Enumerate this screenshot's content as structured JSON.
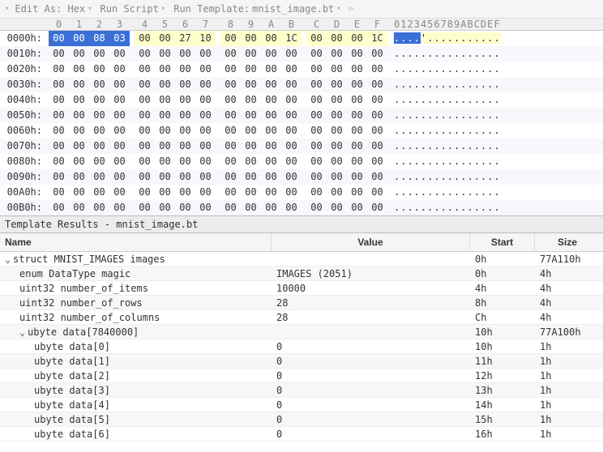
{
  "toolbar": {
    "edit_as": "Edit As: Hex",
    "run_script": "Run Script",
    "run_template_label": "Run Template:",
    "run_template_value": "mnist_image.bt"
  },
  "hex_header": [
    "0",
    "1",
    "2",
    "3",
    "4",
    "5",
    "6",
    "7",
    "8",
    "9",
    "A",
    "B",
    "C",
    "D",
    "E",
    "F"
  ],
  "ascii_header": "0123456789ABCDEF",
  "hex_rows": [
    {
      "addr": "0000h:",
      "bytes": [
        "00",
        "00",
        "08",
        "03",
        "00",
        "00",
        "27",
        "10",
        "00",
        "00",
        "00",
        "1C",
        "00",
        "00",
        "00",
        "1C"
      ],
      "ascii": "....'..........."
    },
    {
      "addr": "0010h:",
      "bytes": [
        "00",
        "00",
        "00",
        "00",
        "00",
        "00",
        "00",
        "00",
        "00",
        "00",
        "00",
        "00",
        "00",
        "00",
        "00",
        "00"
      ],
      "ascii": "................"
    },
    {
      "addr": "0020h:",
      "bytes": [
        "00",
        "00",
        "00",
        "00",
        "00",
        "00",
        "00",
        "00",
        "00",
        "00",
        "00",
        "00",
        "00",
        "00",
        "00",
        "00"
      ],
      "ascii": "................"
    },
    {
      "addr": "0030h:",
      "bytes": [
        "00",
        "00",
        "00",
        "00",
        "00",
        "00",
        "00",
        "00",
        "00",
        "00",
        "00",
        "00",
        "00",
        "00",
        "00",
        "00"
      ],
      "ascii": "................"
    },
    {
      "addr": "0040h:",
      "bytes": [
        "00",
        "00",
        "00",
        "00",
        "00",
        "00",
        "00",
        "00",
        "00",
        "00",
        "00",
        "00",
        "00",
        "00",
        "00",
        "00"
      ],
      "ascii": "................"
    },
    {
      "addr": "0050h:",
      "bytes": [
        "00",
        "00",
        "00",
        "00",
        "00",
        "00",
        "00",
        "00",
        "00",
        "00",
        "00",
        "00",
        "00",
        "00",
        "00",
        "00"
      ],
      "ascii": "................"
    },
    {
      "addr": "0060h:",
      "bytes": [
        "00",
        "00",
        "00",
        "00",
        "00",
        "00",
        "00",
        "00",
        "00",
        "00",
        "00",
        "00",
        "00",
        "00",
        "00",
        "00"
      ],
      "ascii": "................"
    },
    {
      "addr": "0070h:",
      "bytes": [
        "00",
        "00",
        "00",
        "00",
        "00",
        "00",
        "00",
        "00",
        "00",
        "00",
        "00",
        "00",
        "00",
        "00",
        "00",
        "00"
      ],
      "ascii": "................"
    },
    {
      "addr": "0080h:",
      "bytes": [
        "00",
        "00",
        "00",
        "00",
        "00",
        "00",
        "00",
        "00",
        "00",
        "00",
        "00",
        "00",
        "00",
        "00",
        "00",
        "00"
      ],
      "ascii": "................"
    },
    {
      "addr": "0090h:",
      "bytes": [
        "00",
        "00",
        "00",
        "00",
        "00",
        "00",
        "00",
        "00",
        "00",
        "00",
        "00",
        "00",
        "00",
        "00",
        "00",
        "00"
      ],
      "ascii": "................"
    },
    {
      "addr": "00A0h:",
      "bytes": [
        "00",
        "00",
        "00",
        "00",
        "00",
        "00",
        "00",
        "00",
        "00",
        "00",
        "00",
        "00",
        "00",
        "00",
        "00",
        "00"
      ],
      "ascii": "................"
    },
    {
      "addr": "00B0h:",
      "bytes": [
        "00",
        "00",
        "00",
        "00",
        "00",
        "00",
        "00",
        "00",
        "00",
        "00",
        "00",
        "00",
        "00",
        "00",
        "00",
        "00"
      ],
      "ascii": "................"
    }
  ],
  "results_title": "Template Results - mnist_image.bt",
  "results_header": {
    "name": "Name",
    "value": "Value",
    "start": "Start",
    "size": "Size"
  },
  "results_rows": [
    {
      "indent": 0,
      "exp": "v",
      "name": "struct MNIST_IMAGES images",
      "value": "",
      "start": "0h",
      "size": "77A110h"
    },
    {
      "indent": 1,
      "exp": "",
      "name": "enum DataType magic",
      "value": "IMAGES (2051)",
      "start": "0h",
      "size": "4h"
    },
    {
      "indent": 1,
      "exp": "",
      "name": "uint32 number_of_items",
      "value": "10000",
      "start": "4h",
      "size": "4h"
    },
    {
      "indent": 1,
      "exp": "",
      "name": "uint32 number_of_rows",
      "value": "28",
      "start": "8h",
      "size": "4h"
    },
    {
      "indent": 1,
      "exp": "",
      "name": "uint32 number_of_columns",
      "value": "28",
      "start": "Ch",
      "size": "4h"
    },
    {
      "indent": 1,
      "exp": "v",
      "name": "ubyte data[7840000]",
      "value": "",
      "start": "10h",
      "size": "77A100h"
    },
    {
      "indent": 2,
      "exp": "",
      "name": "ubyte data[0]",
      "value": "0",
      "start": "10h",
      "size": "1h"
    },
    {
      "indent": 2,
      "exp": "",
      "name": "ubyte data[1]",
      "value": "0",
      "start": "11h",
      "size": "1h"
    },
    {
      "indent": 2,
      "exp": "",
      "name": "ubyte data[2]",
      "value": "0",
      "start": "12h",
      "size": "1h"
    },
    {
      "indent": 2,
      "exp": "",
      "name": "ubyte data[3]",
      "value": "0",
      "start": "13h",
      "size": "1h"
    },
    {
      "indent": 2,
      "exp": "",
      "name": "ubyte data[4]",
      "value": "0",
      "start": "14h",
      "size": "1h"
    },
    {
      "indent": 2,
      "exp": "",
      "name": "ubyte data[5]",
      "value": "0",
      "start": "15h",
      "size": "1h"
    },
    {
      "indent": 2,
      "exp": "",
      "name": "ubyte data[6]",
      "value": "0",
      "start": "16h",
      "size": "1h"
    }
  ]
}
